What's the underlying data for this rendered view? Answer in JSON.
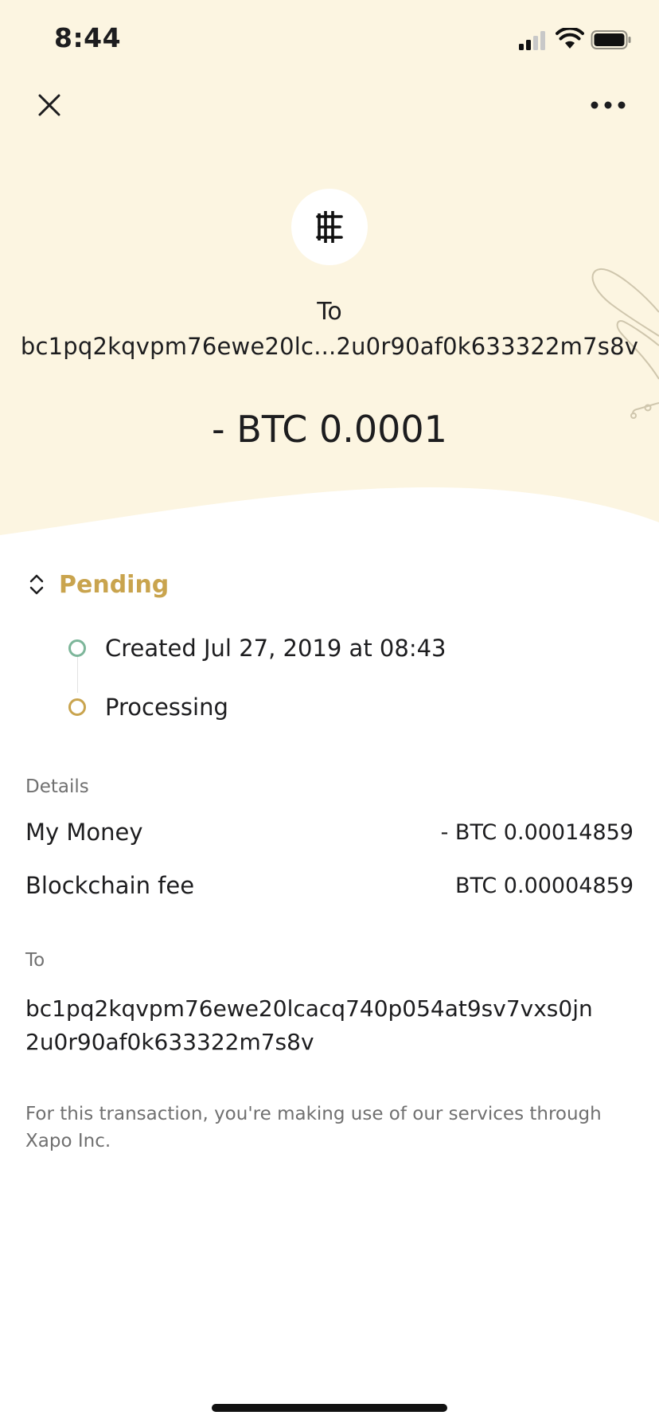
{
  "status_bar": {
    "time": "8:44"
  },
  "header": {
    "close_icon": "close-icon",
    "more_icon": "more-horizontal-icon",
    "coin_icon": "bitcoin-icon",
    "to_label": "To",
    "to_address_short": "bc1pq2kqvpm76ewe20lc...2u0r90af0k633322m7s8v",
    "amount": "- BTC 0.0001"
  },
  "status": {
    "label": "Pending",
    "timeline": [
      {
        "text": "Created Jul 27, 2019 at 08:43",
        "state": "done"
      },
      {
        "text": "Processing",
        "state": "current"
      }
    ]
  },
  "details": {
    "label": "Details",
    "rows": [
      {
        "label": "My Money",
        "value": "- BTC 0.00014859"
      },
      {
        "label": "Blockchain fee",
        "value": "BTC 0.00004859"
      }
    ]
  },
  "recipient": {
    "label": "To",
    "address_line1": "bc1pq2kqvpm76ewe20lcacq740p054at9sv7vxs0jn",
    "address_line2": "2u0r90af0k633322m7s8v"
  },
  "disclaimer": "For this transaction, you're making use of our services through Xapo Inc.",
  "colors": {
    "header_bg": "#fcf5e1",
    "accent_pending": "#c9a44e",
    "timeline_done": "#7db69a"
  }
}
